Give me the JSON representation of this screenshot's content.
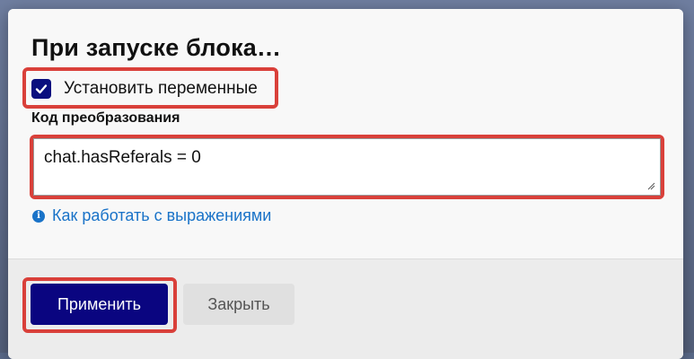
{
  "dialog": {
    "title": "При запуске блока…",
    "set_variables": {
      "label": "Установить переменные",
      "checked": true
    },
    "code": {
      "label": "Код преобразования",
      "value": "chat.hasReferals = 0"
    },
    "help_link": {
      "label": "Как работать с выражениями",
      "icon": "info-icon"
    },
    "buttons": {
      "apply": "Применить",
      "close": "Закрыть"
    }
  },
  "colors": {
    "primary": "#0a0580",
    "highlight": "#d9403a",
    "link": "#1a73c8"
  }
}
